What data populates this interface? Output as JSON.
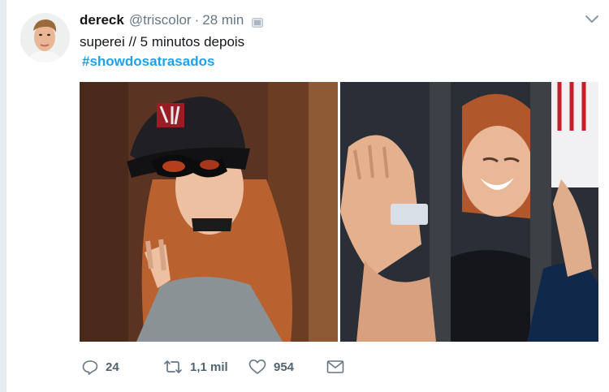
{
  "tweet": {
    "author_name": "dereck",
    "author_handle": "@triscolor",
    "separator": "·",
    "timestamp": "28 min",
    "text": "superei // 5 minutos depois",
    "hashtag": "#showdosatrasados"
  },
  "actions": {
    "reply_count": "24",
    "retweet_count": "1,1 mil",
    "like_count": "954"
  },
  "icons": [
    "verified-badge-icon",
    "chevron-down-icon",
    "reply-icon",
    "retweet-icon",
    "like-icon",
    "direct-message-icon"
  ],
  "colors": {
    "link_blue": "#1da1f2",
    "muted_gray": "#657786",
    "action_gray": "#536471",
    "background": "#e6ecf0"
  }
}
